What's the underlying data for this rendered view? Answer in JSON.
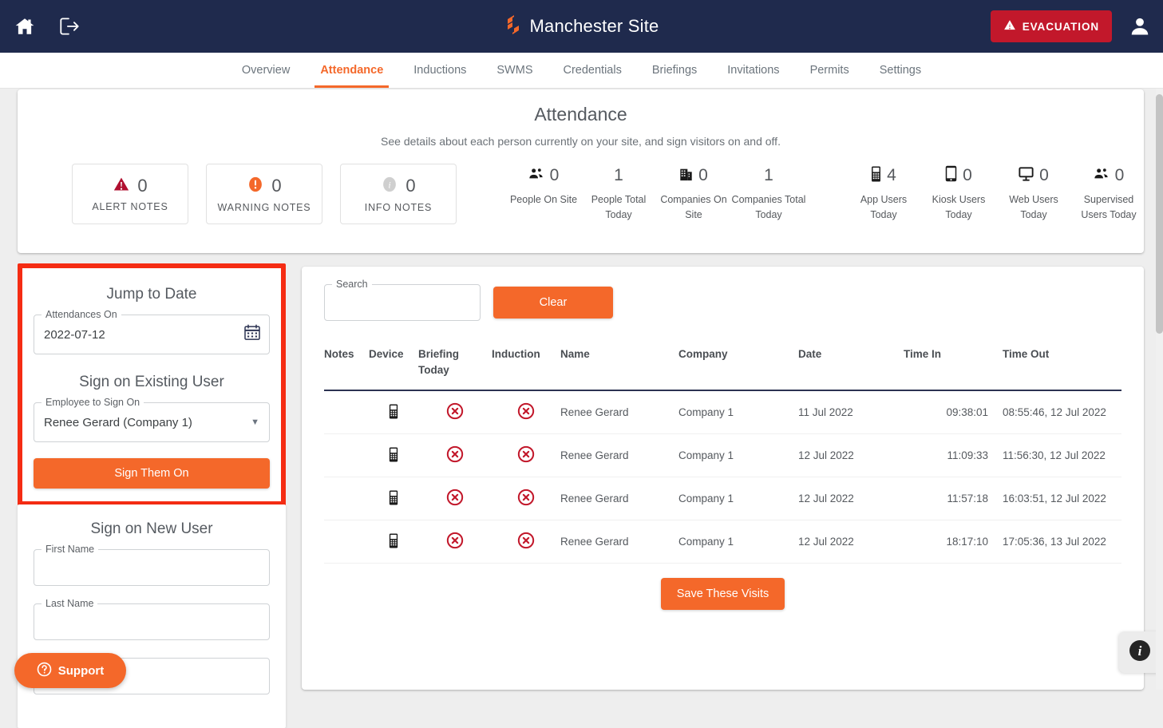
{
  "topbar": {
    "home_icon": "home-icon",
    "logout_icon": "logout-icon",
    "brand_logo": "site-logo-icon",
    "site_title": "Manchester Site",
    "evacuation_label": "EVACUATION",
    "evacuation_icon": "warning-triangle-icon",
    "account_icon": "user-avatar-icon",
    "bg_color": "#1f2a4d",
    "evacuation_color": "#c2182b"
  },
  "nav": {
    "tabs": [
      {
        "label": "Overview",
        "active": false
      },
      {
        "label": "Attendance",
        "active": true
      },
      {
        "label": "Inductions",
        "active": false
      },
      {
        "label": "SWMS",
        "active": false
      },
      {
        "label": "Credentials",
        "active": false
      },
      {
        "label": "Briefings",
        "active": false
      },
      {
        "label": "Invitations",
        "active": false
      },
      {
        "label": "Permits",
        "active": false
      },
      {
        "label": "Settings",
        "active": false
      }
    ],
    "accent_color": "#f4682a"
  },
  "summary": {
    "title": "Attendance",
    "subtitle": "See details about each person currently on your site, and sign visitors on and off.",
    "note_boxes": [
      {
        "icon": "alert-triangle-icon",
        "value": "0",
        "label": "ALERT NOTES",
        "color": "#b01030"
      },
      {
        "icon": "warning-exclamation-icon",
        "value": "0",
        "label": "WARNING NOTES",
        "color": "#f4682a"
      },
      {
        "icon": "info-circle-icon",
        "value": "0",
        "label": "INFO NOTES",
        "color": "#cfcfcf"
      }
    ],
    "metrics": [
      {
        "icon": "people-group-icon",
        "value": "0",
        "label": "People On Site"
      },
      {
        "icon": "",
        "value": "1",
        "label": "People Total Today"
      },
      {
        "icon": "building-icon",
        "value": "0",
        "label": "Companies On Site"
      },
      {
        "icon": "",
        "value": "1",
        "label": "Companies Total Today"
      }
    ],
    "metrics2": [
      {
        "icon": "mobile-phone-icon",
        "value": "4",
        "label": "App Users Today"
      },
      {
        "icon": "tablet-icon",
        "value": "0",
        "label": "Kiosk Users Today"
      },
      {
        "icon": "desktop-monitor-icon",
        "value": "0",
        "label": "Web Users Today"
      },
      {
        "icon": "supervised-people-icon",
        "value": "0",
        "label": "Supervised Users Today"
      }
    ]
  },
  "jump_to_date": {
    "heading": "Jump to Date",
    "field_label": "Attendances On",
    "field_value": "2022-07-12",
    "calendar_icon": "calendar-icon",
    "highlight_color": "#f52c13"
  },
  "sign_existing": {
    "heading": "Sign on Existing User",
    "field_label": "Employee to Sign On",
    "selected_value": "Renee Gerard (Company 1)",
    "dropdown_icon": "chevron-down-icon",
    "button_label": "Sign Them On"
  },
  "sign_new": {
    "heading": "Sign on New User",
    "first_name_label": "First Name",
    "first_name_value": "",
    "last_name_label": "Last Name",
    "last_name_value": ""
  },
  "search": {
    "label": "Search",
    "value": "",
    "placeholder": "",
    "clear_label": "Clear"
  },
  "table": {
    "columns": [
      "Notes",
      "Device",
      "Briefing Today",
      "Induction",
      "Name",
      "Company",
      "Date",
      "Time In",
      "Time Out"
    ],
    "rows": [
      {
        "notes": "",
        "device": "mobile-phone-icon",
        "briefing_today": "red-x-circle-icon",
        "induction": "red-x-circle-icon",
        "name": "Renee Gerard",
        "company": "Company 1",
        "date": "11 Jul 2022",
        "time_in": "09:38:01",
        "time_out": "08:55:46, 12 Jul 2022"
      },
      {
        "notes": "",
        "device": "mobile-phone-icon",
        "briefing_today": "red-x-circle-icon",
        "induction": "red-x-circle-icon",
        "name": "Renee Gerard",
        "company": "Company 1",
        "date": "12 Jul 2022",
        "time_in": "11:09:33",
        "time_out": "11:56:30, 12 Jul 2022"
      },
      {
        "notes": "",
        "device": "mobile-phone-icon",
        "briefing_today": "red-x-circle-icon",
        "induction": "red-x-circle-icon",
        "name": "Renee Gerard",
        "company": "Company 1",
        "date": "12 Jul 2022",
        "time_in": "11:57:18",
        "time_out": "16:03:51, 12 Jul 2022"
      },
      {
        "notes": "",
        "device": "mobile-phone-icon",
        "briefing_today": "red-x-circle-icon",
        "induction": "red-x-circle-icon",
        "name": "Renee Gerard",
        "company": "Company 1",
        "date": "12 Jul 2022",
        "time_in": "18:17:10",
        "time_out": "17:05:36, 13 Jul 2022"
      }
    ],
    "save_label": "Save These Visits"
  },
  "floating": {
    "support_label": "Support",
    "support_icon": "question-circle-icon",
    "info_icon": "info-circle-icon"
  }
}
